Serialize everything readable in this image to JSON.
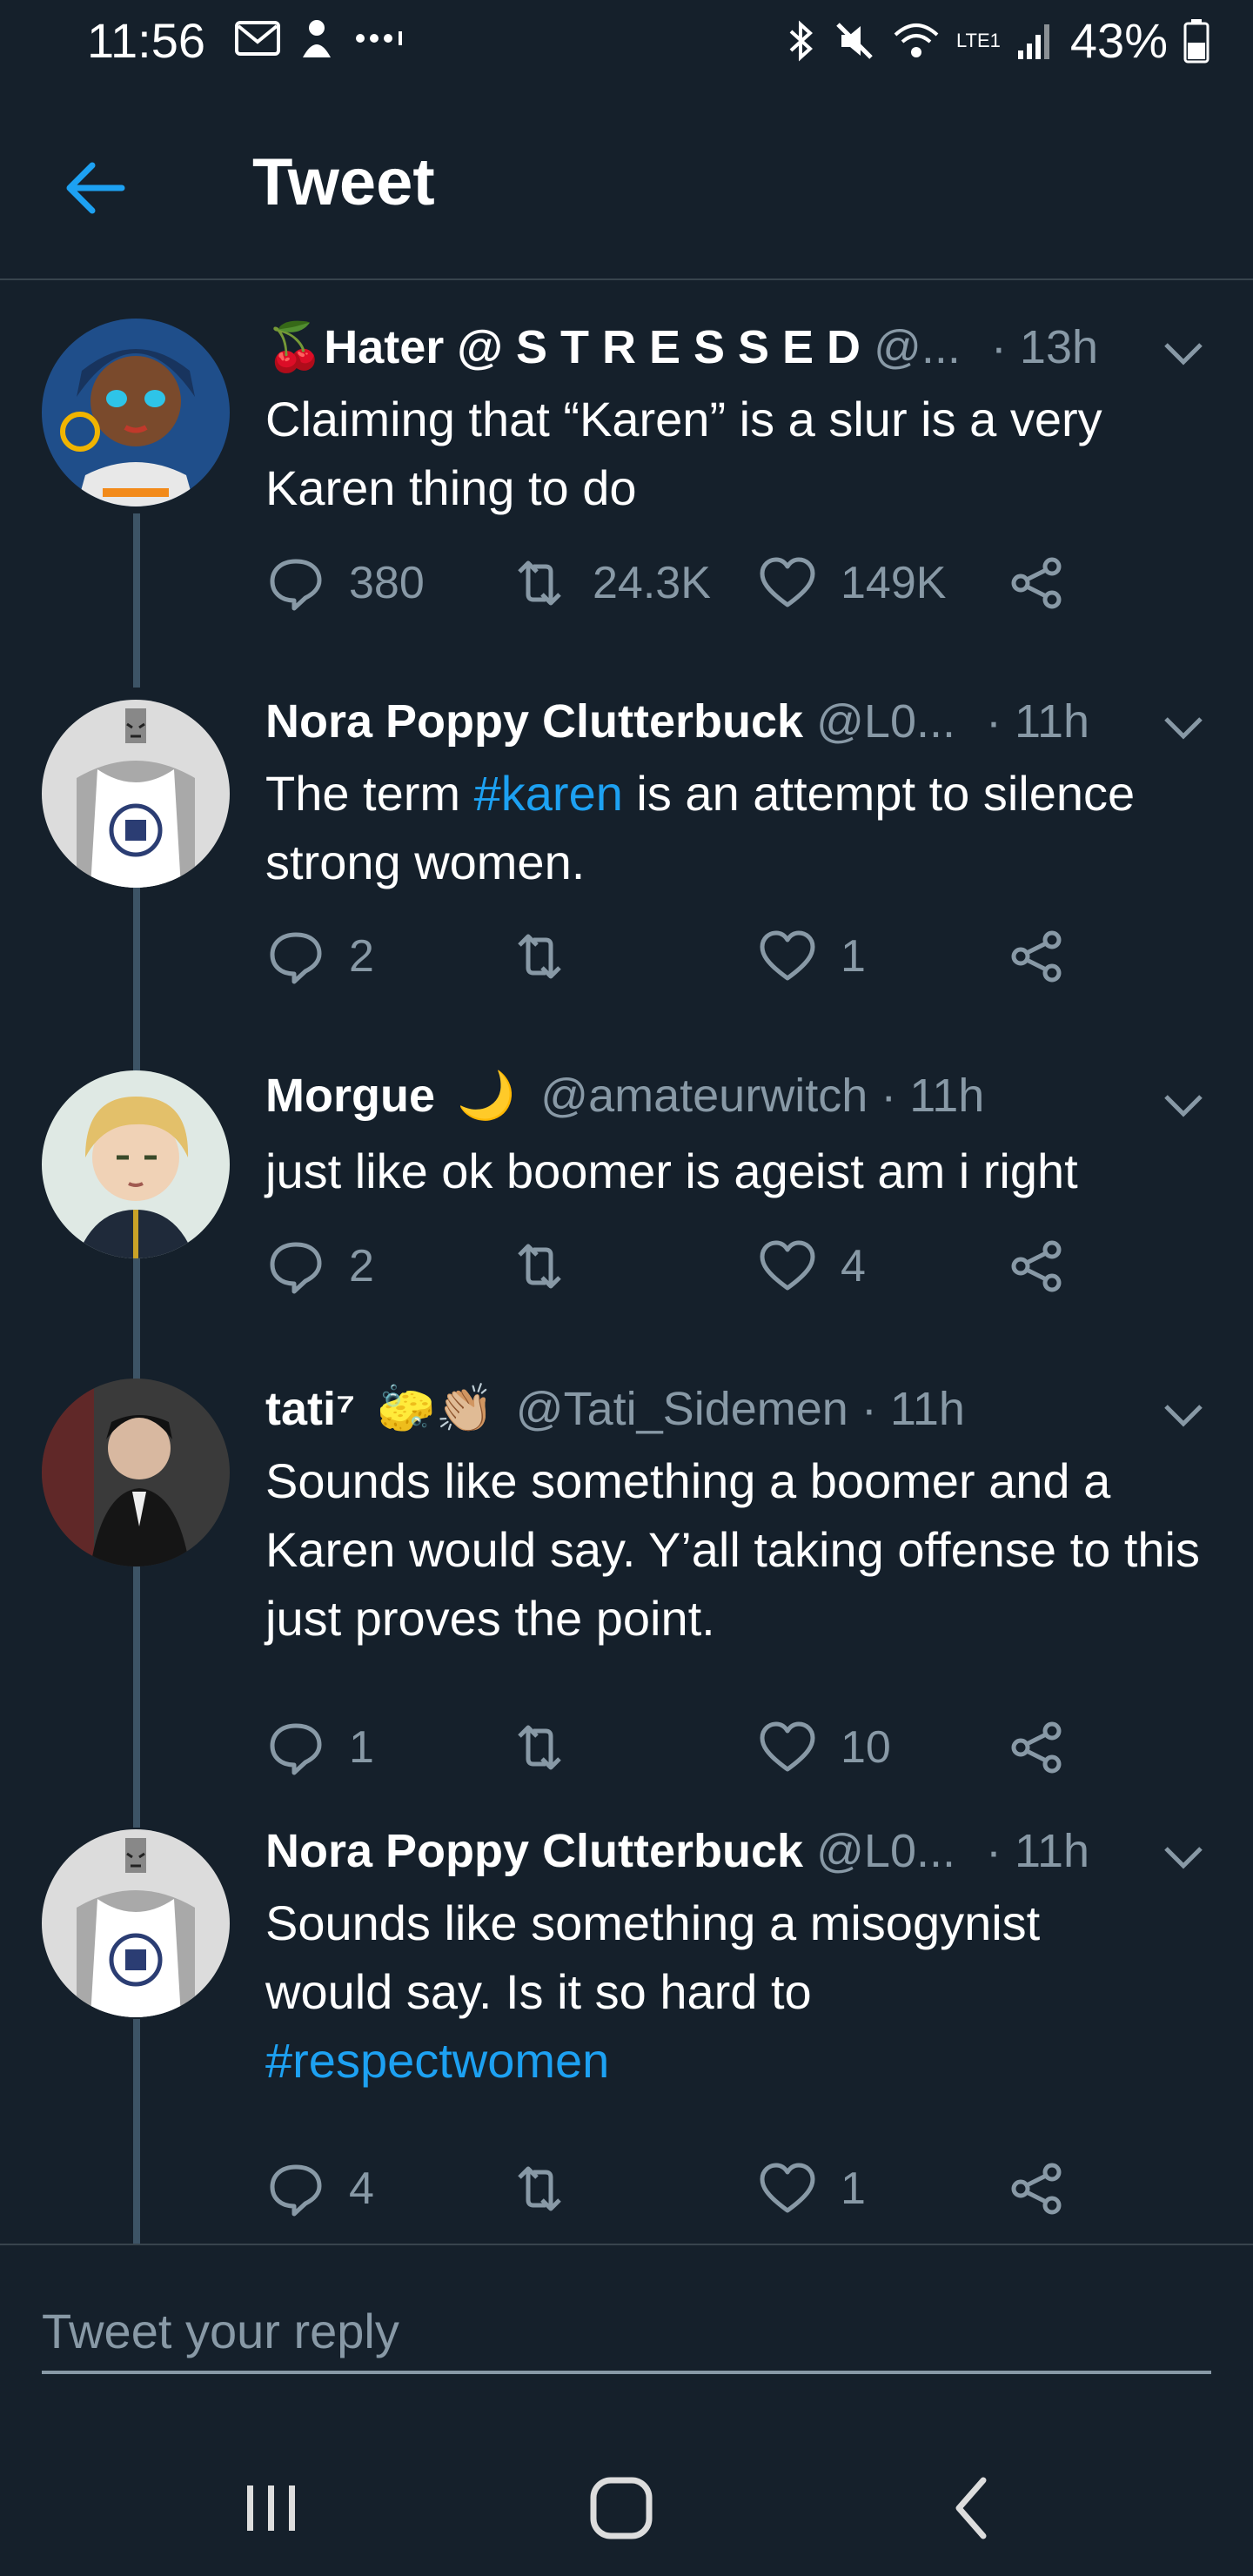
{
  "status_bar": {
    "time": "11:56",
    "battery": "43%",
    "network": "LTE1"
  },
  "header": {
    "title": "Tweet"
  },
  "tweets": [
    {
      "emoji": "🍒",
      "name": "Hater @ S T R E S S E D",
      "handle": "@...",
      "time": "· 13h",
      "text": "Claiming that “Karen” is a slur is a very Karen thing to do",
      "replies": "380",
      "retweets": "24.3K",
      "likes": "149K"
    },
    {
      "name": "Nora Poppy Clutterbuck",
      "handle": "@L0...",
      "time": "· 11h",
      "text_before": "The term ",
      "hashtag": "#karen",
      "text_after": " is an attempt to silence strong women.",
      "replies": "2",
      "retweets": "",
      "likes": "1"
    },
    {
      "name": "Morgue",
      "emoji_after": "🌙",
      "handle": "@amateurwitch",
      "time": "· 11h",
      "text": "just like ok boomer is ageist am i right",
      "replies": "2",
      "retweets": "",
      "likes": "4"
    },
    {
      "name": "tati⁷",
      "emoji_after": "🧽👏🏼",
      "handle": "@Tati_Sidemen",
      "time": "· 11h",
      "text": "Sounds like something a boomer and a Karen would say. Y’all taking offense to this just proves the point.",
      "replies": "1",
      "retweets": "",
      "likes": "10"
    },
    {
      "name": "Nora Poppy Clutterbuck",
      "handle": "@L0...",
      "time": "· 11h",
      "text_before": "Sounds like something a misogynist would say. Is it so hard to ",
      "hashtag": "#respectwomen",
      "replies": "4",
      "retweets": "",
      "likes": "1"
    }
  ],
  "reply_bar": {
    "placeholder": "Tweet your reply"
  },
  "colors": {
    "background": "#15202b",
    "accent": "#1da1f2",
    "secondary_text": "#8899a6",
    "divider": "#38444d"
  }
}
